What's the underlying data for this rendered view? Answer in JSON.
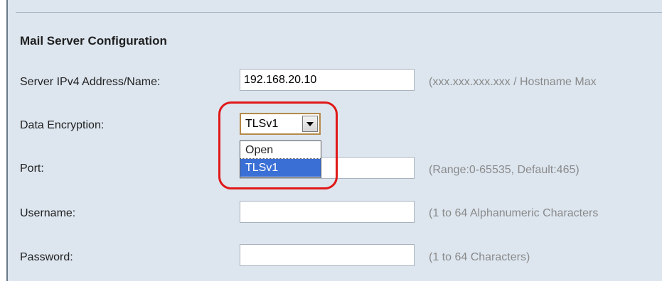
{
  "section": {
    "title": "Mail Server Configuration"
  },
  "fields": {
    "server": {
      "label": "Server IPv4 Address/Name:",
      "value": "192.168.20.10",
      "hint": "(xxx.xxx.xxx.xxx / Hostname Max"
    },
    "encryption": {
      "label": "Data Encryption:",
      "selected": "TLSv1",
      "options": [
        "Open",
        "TLSv1"
      ],
      "highlighted_option": "TLSv1"
    },
    "port": {
      "label": "Port:",
      "value": "",
      "hint": "(Range:0-65535, Default:465)"
    },
    "username": {
      "label": "Username:",
      "value": "",
      "hint": "(1 to 64 Alphanumeric Characters"
    },
    "password": {
      "label": "Password:",
      "value": "",
      "hint": "(1 to 64 Characters)"
    }
  },
  "icons": {
    "select_arrow": "chevron-down-icon"
  },
  "colors": {
    "panel_bg": "#dde6ef",
    "callout": "#e01818",
    "selection": "#3a6fd6",
    "select_border": "#b58a4a"
  }
}
